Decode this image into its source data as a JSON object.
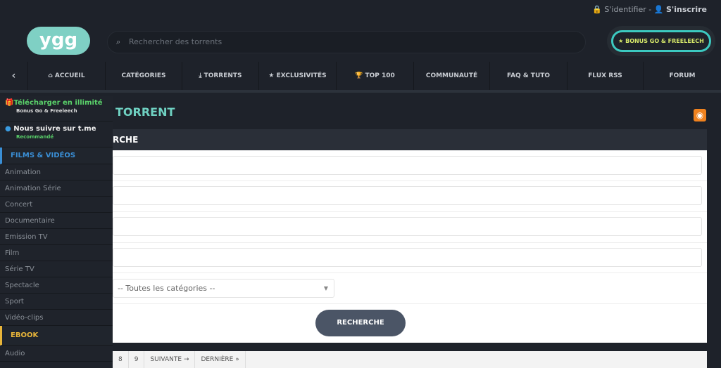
{
  "header": {
    "login": "S'identifier",
    "separator": "-",
    "register": "S'inscrire",
    "logo": "ygg",
    "search_placeholder": "Rechercher des torrents",
    "bonus_button": "BONUS GO & FREELEECH"
  },
  "nav": {
    "back": "‹",
    "items": [
      "ACCUEIL",
      "CATÉGORIES",
      "TORRENTS",
      "EXCLUSIVITÉS",
      "TOP 100",
      "COMMUNAUTÉ",
      "FAQ & TUTO",
      "FLUX RSS",
      "FORUM"
    ]
  },
  "main": {
    "title": "TORRENT",
    "panel_title": "RCHE",
    "category_select": "-- Toutes les catégories --",
    "search_button": "RECHERCHE"
  },
  "pagination": [
    "8",
    "9",
    "SUIVANTE →",
    "DERNIÈRE »"
  ],
  "sidebar": {
    "promo1": {
      "title": "Télécharger en illimité",
      "subtitle": "Bonus Go & Freeleech"
    },
    "promo2": {
      "title": "Nous suivre sur t.me",
      "subtitle": "Recommandé"
    },
    "cat1": {
      "label": "FILMS & VIDÉOS",
      "color": "#3a8fd6"
    },
    "items": [
      "Animation",
      "Animation Série",
      "Concert",
      "Documentaire",
      "Emission TV",
      "Film",
      "Série TV",
      "Spectacle",
      "Sport",
      "Vidéo-clips"
    ],
    "cat2": {
      "label": "EBOOK",
      "color": "#e8b53a"
    },
    "items2": [
      "Audio"
    ]
  },
  "colors": {
    "accent": "#6fd1c2",
    "bonus_border": "#3cc9c0"
  }
}
